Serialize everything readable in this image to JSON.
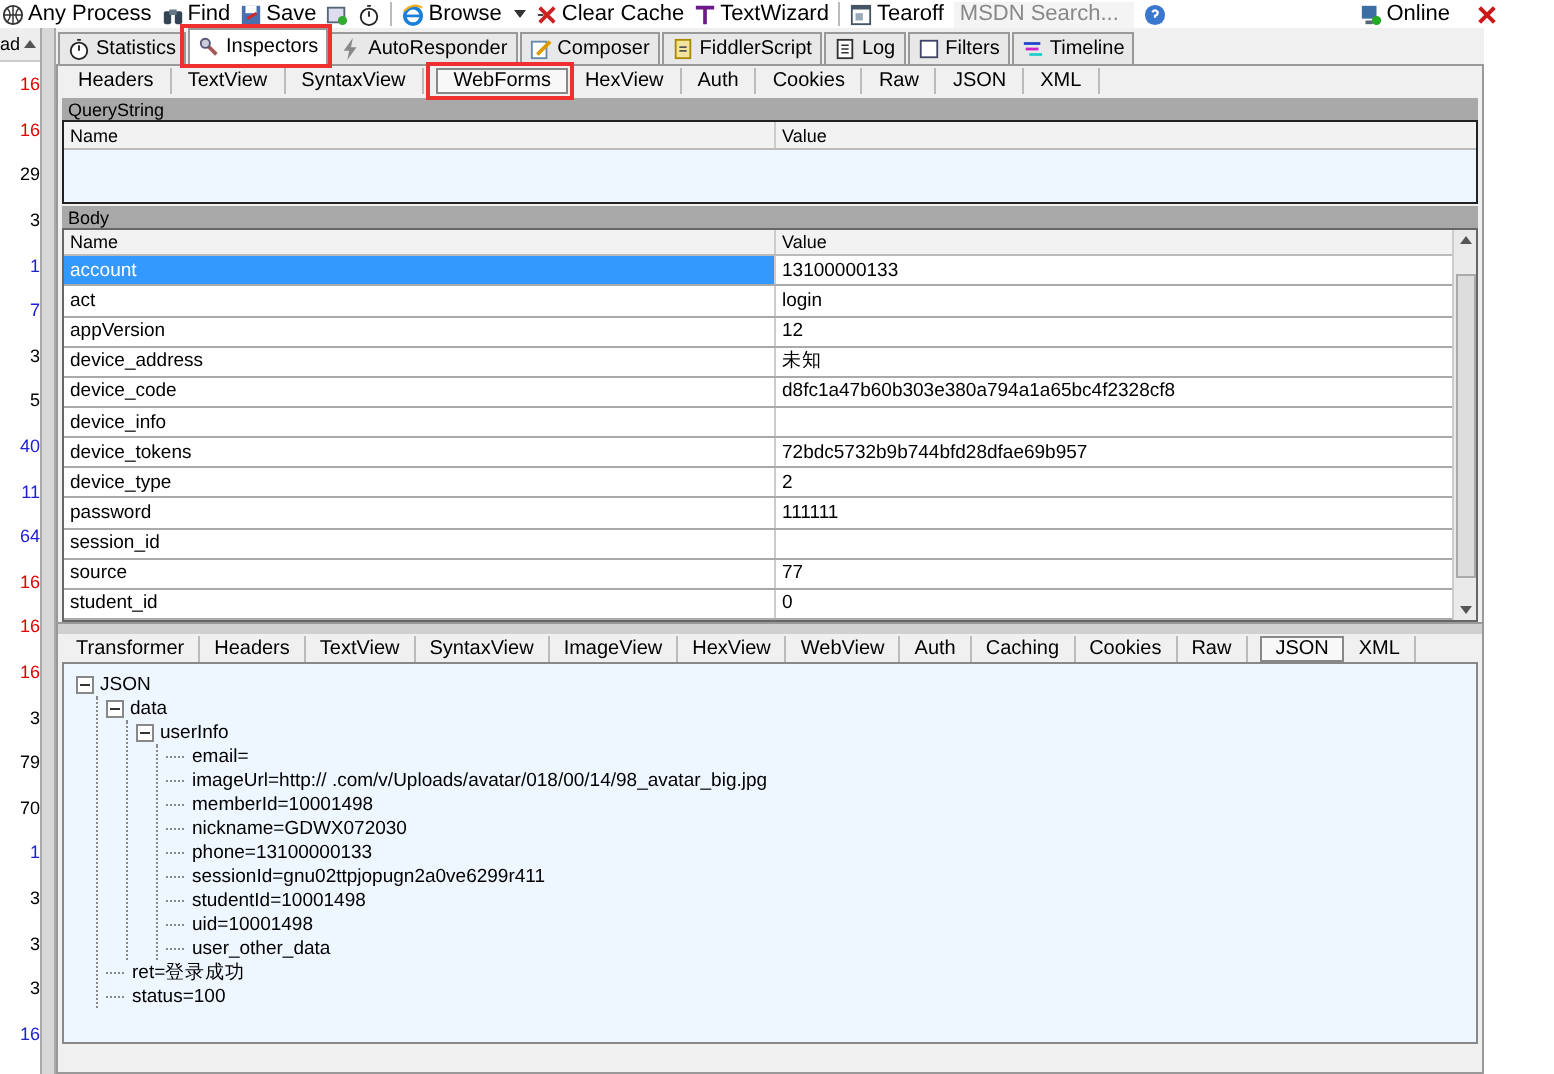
{
  "toolbar": {
    "items": [
      {
        "label": "Any Process"
      },
      {
        "label": "Find"
      },
      {
        "label": "Save"
      },
      {
        "label": "Browse"
      },
      {
        "label": "Clear Cache"
      },
      {
        "label": "TextWizard"
      },
      {
        "label": "Tearoff"
      }
    ],
    "search": {
      "placeholder": "MSDN Search..."
    },
    "status": "Online"
  },
  "session_list": {
    "column_1": "ad",
    "rows": [
      {
        "text": "16",
        "color": "#e00000"
      },
      {
        "text": "16",
        "color": "#e00000"
      },
      {
        "text": "29",
        "color": "#000000"
      },
      {
        "text": "3",
        "color": "#000000"
      },
      {
        "text": "1",
        "color": "#2020d0"
      },
      {
        "text": "7",
        "color": "#2020d0"
      },
      {
        "text": "3",
        "color": "#000000"
      },
      {
        "text": "5",
        "color": "#000000"
      },
      {
        "text": "40",
        "color": "#2020d0"
      },
      {
        "text": "11",
        "color": "#2020d0"
      },
      {
        "text": "64",
        "color": "#2020d0"
      },
      {
        "text": "16",
        "color": "#e00000"
      },
      {
        "text": "16",
        "color": "#e00000"
      },
      {
        "text": "16",
        "color": "#e00000"
      },
      {
        "text": "3",
        "color": "#000000"
      },
      {
        "text": "79",
        "color": "#000000"
      },
      {
        "text": "70",
        "color": "#000000"
      },
      {
        "text": "1",
        "color": "#2020d0"
      },
      {
        "text": "3",
        "color": "#000000"
      },
      {
        "text": "3",
        "color": "#000000"
      },
      {
        "text": "3",
        "color": "#000000"
      },
      {
        "text": "16",
        "color": "#2020d0"
      }
    ]
  },
  "tabs": [
    {
      "label": "Statistics",
      "selected": false
    },
    {
      "label": "Inspectors",
      "selected": true
    },
    {
      "label": "AutoResponder",
      "selected": false
    },
    {
      "label": "Composer",
      "selected": false
    },
    {
      "label": "FiddlerScript",
      "selected": false
    },
    {
      "label": "Log",
      "selected": false
    },
    {
      "label": "Filters",
      "selected": false
    },
    {
      "label": "Timeline",
      "selected": false
    }
  ],
  "request_tabs": [
    {
      "label": "Headers",
      "selected": false
    },
    {
      "label": "TextView",
      "selected": false
    },
    {
      "label": "SyntaxView",
      "selected": false
    },
    {
      "label": "WebForms",
      "selected": true
    },
    {
      "label": "HexView",
      "selected": false
    },
    {
      "label": "Auth",
      "selected": false
    },
    {
      "label": "Cookies",
      "selected": false
    },
    {
      "label": "Raw",
      "selected": false
    },
    {
      "label": "JSON",
      "selected": false
    },
    {
      "label": "XML",
      "selected": false
    }
  ],
  "querystring": {
    "title": "QueryString",
    "columns": [
      "Name",
      "Value"
    ]
  },
  "body": {
    "title": "Body",
    "columns": [
      "Name",
      "Value"
    ],
    "rows": [
      {
        "name": "account",
        "value": "13100000133",
        "selected": true
      },
      {
        "name": "act",
        "value": "login",
        "selected": false
      },
      {
        "name": "appVersion",
        "value": "12",
        "selected": false
      },
      {
        "name": "device_address",
        "value": "未知",
        "selected": false
      },
      {
        "name": "device_code",
        "value": "d8fc1a47b60b303e380a794a1a65bc4f2328cf8",
        "selected": false
      },
      {
        "name": "device_info",
        "value": "",
        "selected": false
      },
      {
        "name": "device_tokens",
        "value": "72bdc5732b9b744bfd28dfae69b957",
        "selected": false
      },
      {
        "name": "device_type",
        "value": "2",
        "selected": false
      },
      {
        "name": "password",
        "value": "111111",
        "selected": false
      },
      {
        "name": "session_id",
        "value": "",
        "selected": false
      },
      {
        "name": "source",
        "value": "77",
        "selected": false
      },
      {
        "name": "student_id",
        "value": "0",
        "selected": false
      }
    ]
  },
  "response_tabs": [
    {
      "label": "Transformer",
      "selected": false
    },
    {
      "label": "Headers",
      "selected": false
    },
    {
      "label": "TextView",
      "selected": false
    },
    {
      "label": "SyntaxView",
      "selected": false
    },
    {
      "label": "ImageView",
      "selected": false
    },
    {
      "label": "HexView",
      "selected": false
    },
    {
      "label": "WebView",
      "selected": false
    },
    {
      "label": "Auth",
      "selected": false
    },
    {
      "label": "Caching",
      "selected": false
    },
    {
      "label": "Cookies",
      "selected": false
    },
    {
      "label": "Raw",
      "selected": false
    },
    {
      "label": "JSON",
      "selected": true
    },
    {
      "label": "XML",
      "selected": false
    }
  ],
  "tree": [
    {
      "label": "JSON",
      "expanded": true,
      "children": [
        {
          "label": "data",
          "expanded": true,
          "children": [
            {
              "label": "userInfo",
              "expanded": true,
              "children": [
                {
                  "label": "email="
                },
                {
                  "label": "imageUrl=http://           .com/v/Uploads/avatar/018/00/14/98_avatar_big.jpg"
                },
                {
                  "label": "memberId=10001498"
                },
                {
                  "label": "nickname=GDWX072030"
                },
                {
                  "label": "phone=13100000133"
                },
                {
                  "label": "sessionId=gnu02ttpjopugn2a0ve6299r411"
                },
                {
                  "label": "studentId=10001498"
                },
                {
                  "label": "uid=10001498"
                },
                {
                  "label": "user_other_data"
                }
              ]
            }
          ]
        },
        {
          "label": "ret=登录成功"
        },
        {
          "label": "status=100"
        }
      ]
    }
  ]
}
